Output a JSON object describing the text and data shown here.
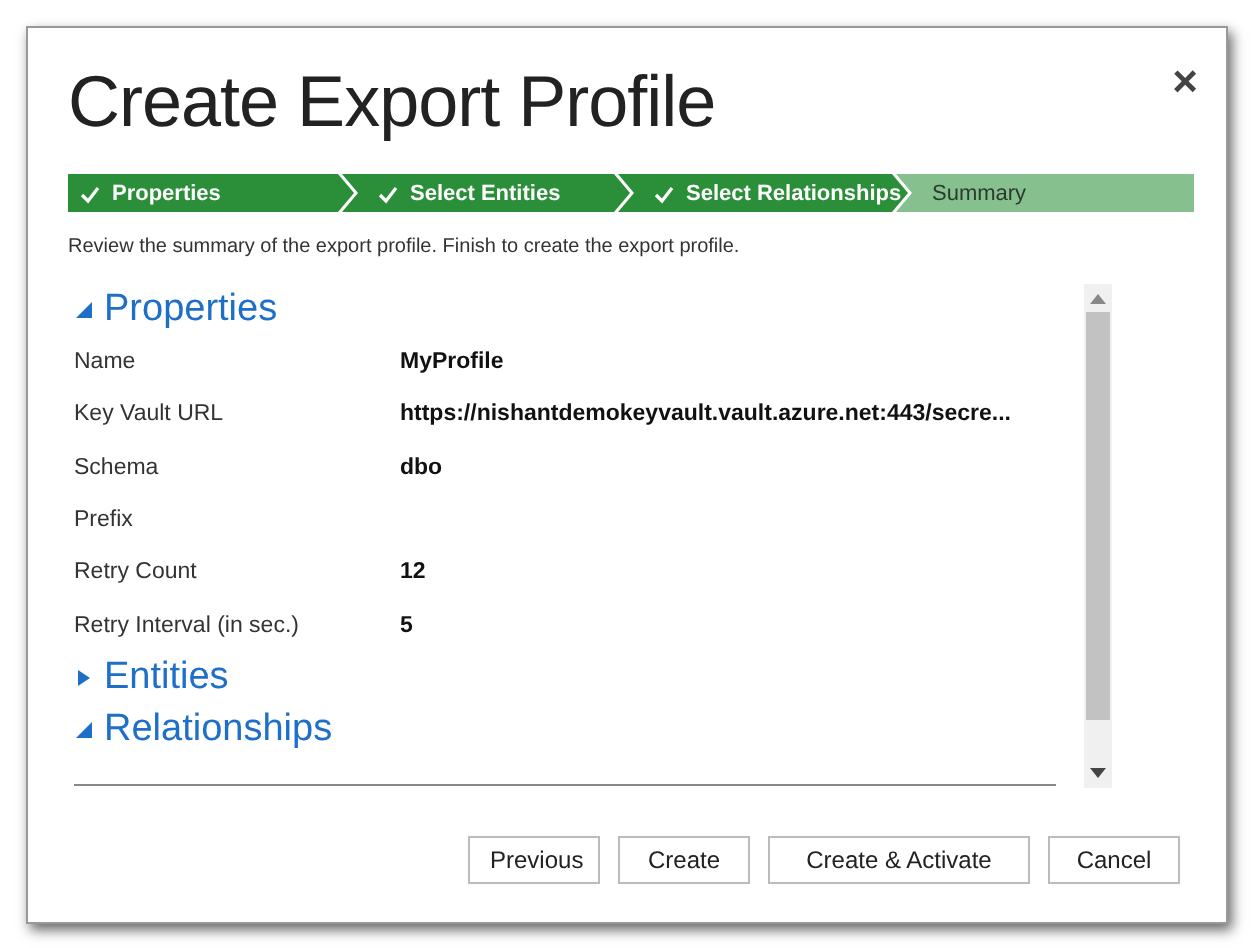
{
  "window": {
    "title": "Create Export Profile",
    "close": "×"
  },
  "steps": [
    {
      "label": "Properties",
      "done": true,
      "selected": false
    },
    {
      "label": "Select Entities",
      "done": true,
      "selected": false
    },
    {
      "label": "Select Relationships",
      "done": true,
      "selected": false
    },
    {
      "label": "Summary",
      "done": false,
      "selected": true
    }
  ],
  "description": "Review the summary of the export profile. Finish to create the export profile.",
  "sections": [
    {
      "title": "Properties",
      "expanded": true,
      "fields": [
        {
          "label": "Name",
          "value": "MyProfile"
        },
        {
          "label": "Key Vault URL",
          "value": "https://nishantdemokeyvault.vault.azure.net:443/secre..."
        },
        {
          "label": "Schema",
          "value": "dbo"
        },
        {
          "label": "Prefix"
        },
        {
          "label": "Retry Count",
          "value": "12"
        },
        {
          "label": "Retry Interval (in sec.)",
          "value": "5"
        }
      ]
    },
    {
      "title": "Entities",
      "expanded": false
    },
    {
      "title": "Relationships",
      "expanded": true
    }
  ],
  "buttons": [
    "Previous",
    "Create",
    "Create & Activate",
    "Cancel"
  ]
}
